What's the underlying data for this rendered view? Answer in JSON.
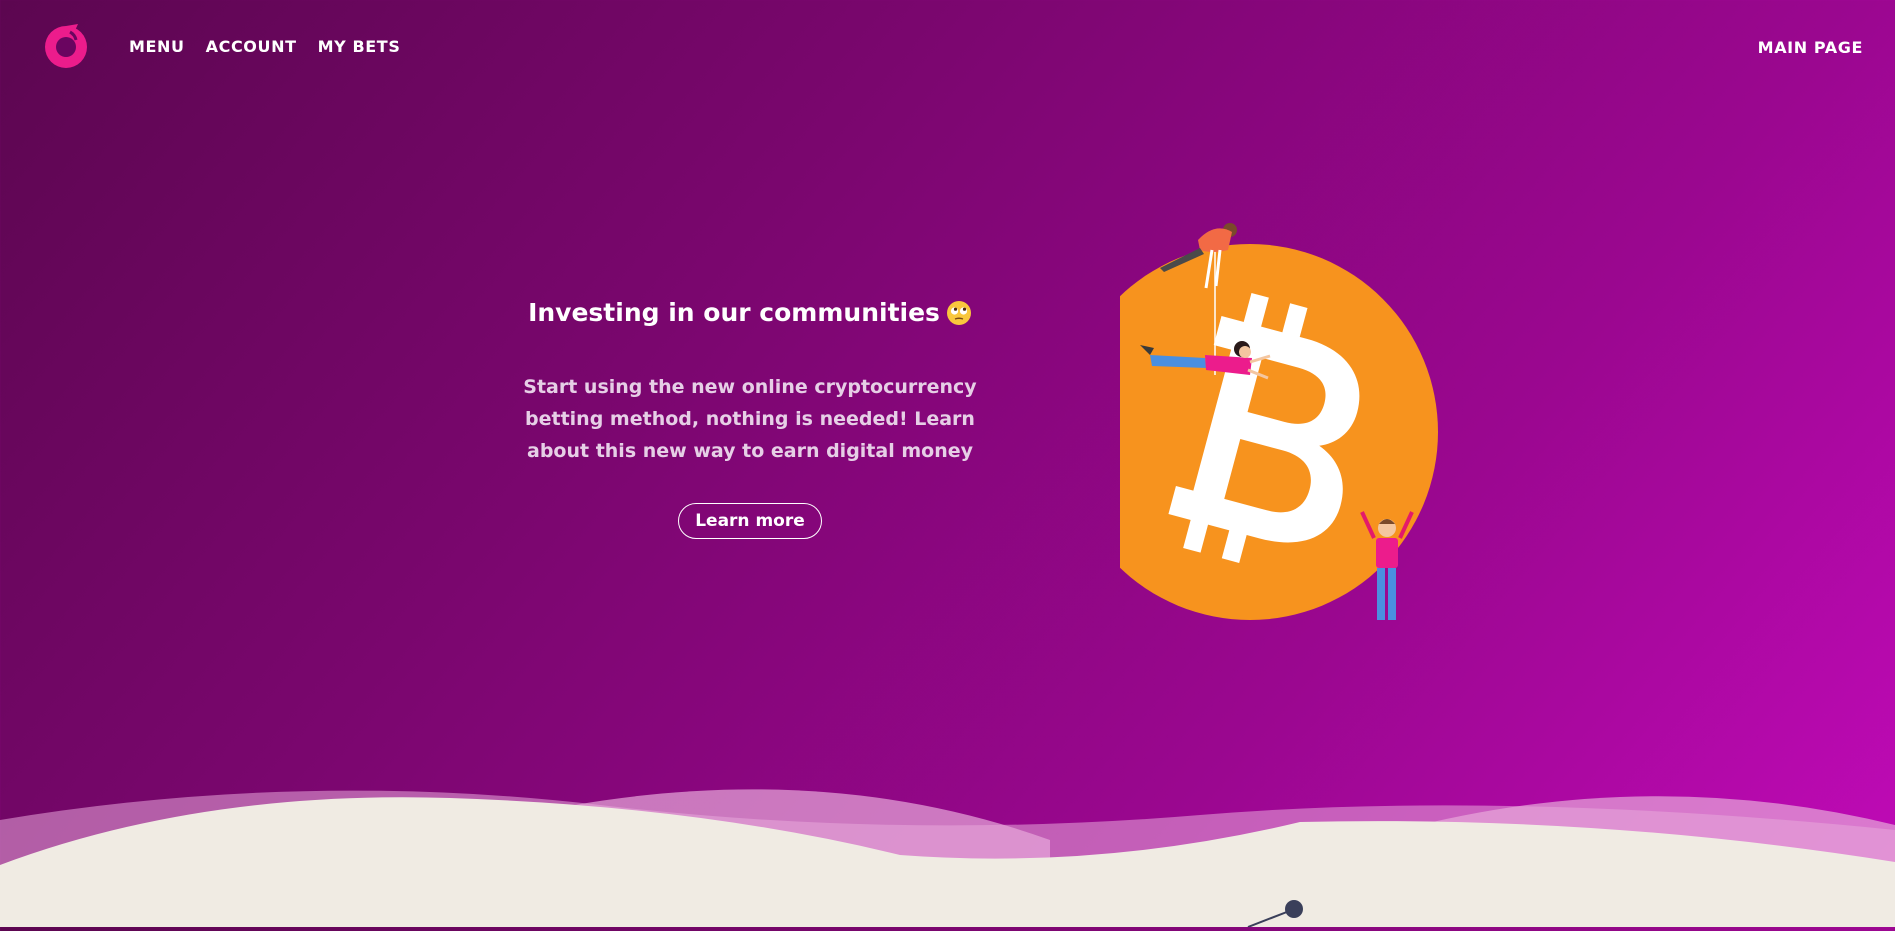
{
  "nav": {
    "logo_icon": "rotating-ring-logo-icon",
    "links": [
      "MENU",
      "ACCOUNT",
      "MY BETS"
    ],
    "main_link": "MAIN PAGE"
  },
  "hero": {
    "title": "Investing in our communities",
    "title_emoji": "rolling-eyes-emoji-icon",
    "description": "Start using the new online cryptocurrency betting method, nothing is needed! Learn about this new way to earn digital money",
    "button_label": "Learn more"
  },
  "illustration": {
    "icon": "bitcoin-coin-with-people-illustration",
    "coin_color": "#f7931e"
  },
  "colors": {
    "accent": "#ec1c8c",
    "bg_start": "#5c0650",
    "bg_end": "#c10ab8",
    "wave_base": "#f0ebe3"
  }
}
